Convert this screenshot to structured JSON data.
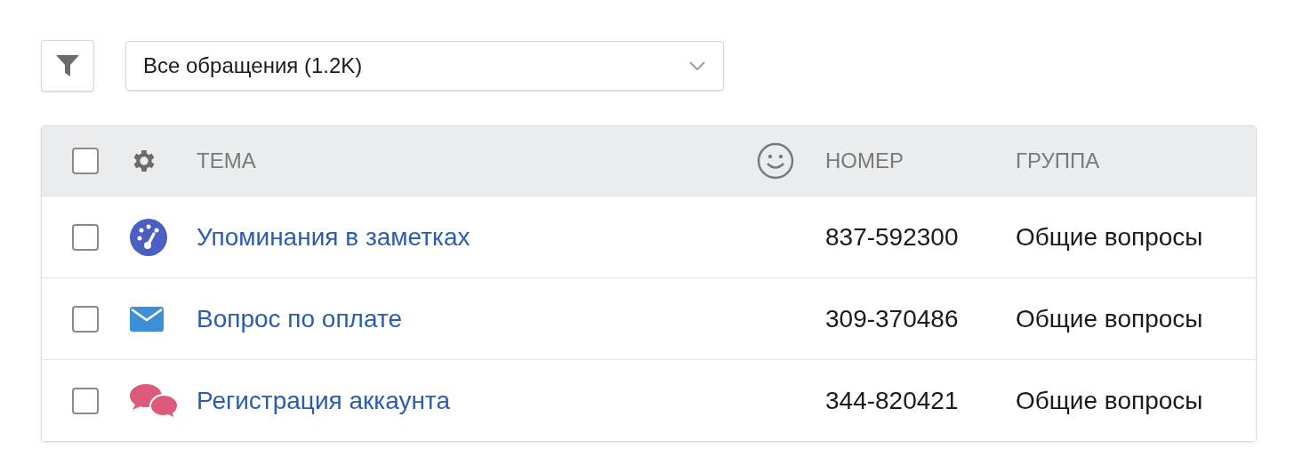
{
  "view_select": {
    "value": "Все обращения (1.2K)"
  },
  "table": {
    "select_all": {
      "checked": false
    },
    "columns": [
      "ТЕМА",
      "НОМЕР",
      "ГРУППА"
    ],
    "rows": [
      {
        "kind": "mention",
        "checked": false,
        "subject": "Упоминания в заметках",
        "number": "837-592300",
        "group": "Общие вопросы"
      },
      {
        "kind": "email",
        "checked": false,
        "subject": "Вопрос по оплате",
        "number": "309-370486",
        "group": "Общие вопросы"
      },
      {
        "kind": "chat",
        "checked": false,
        "subject": "Регистрация аккаунта",
        "number": "344-820421",
        "group": "Общие вопросы"
      }
    ]
  }
}
